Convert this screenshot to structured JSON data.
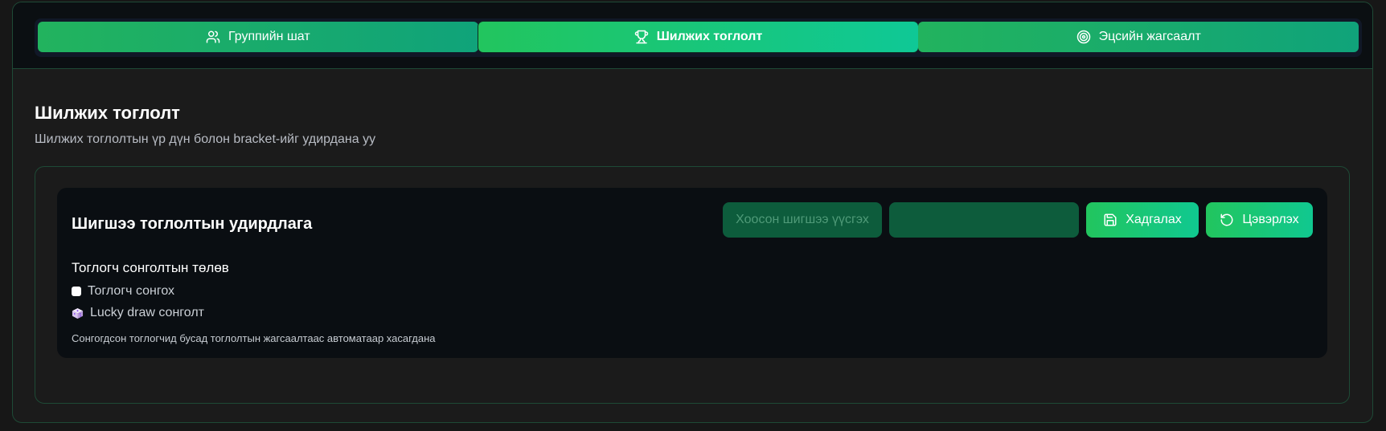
{
  "tabs": [
    {
      "label": "Группийн шат",
      "icon": "users-icon",
      "active": false
    },
    {
      "label": "Шилжих тоглолт",
      "icon": "trophy-icon",
      "active": true
    },
    {
      "label": "Эцсийн жагсаалт",
      "icon": "target-icon",
      "active": false
    }
  ],
  "page": {
    "title": "Шилжих тоглолт",
    "subtitle": "Шилжих тоглолтын үр дүн болон bracket-ийг удирдана уу"
  },
  "card": {
    "title": "Шигшээ тоглолтын удирдлага",
    "buttons": {
      "create_empty": "Хоосон шигшээ үүсгэх",
      "hidden_disabled": "",
      "save": "Хадгалах",
      "reset": "Цэвэрлэх"
    },
    "status": {
      "title": "Тоглогч сонголтын төлөв",
      "items": [
        {
          "label": "Тоглогч сонгох",
          "icon": "checkbox-icon"
        },
        {
          "label": "Lucky draw сонголт",
          "icon": "dice-icon"
        }
      ],
      "note": "Сонгогдсон тоглогчид бусад тоглолтын жагсаалтаас автоматаар хасагдана"
    }
  },
  "colors": {
    "accent": "#22c55e",
    "accent_alt": "#10c890",
    "border": "#1e4a36",
    "background": "#1b1b1b"
  }
}
